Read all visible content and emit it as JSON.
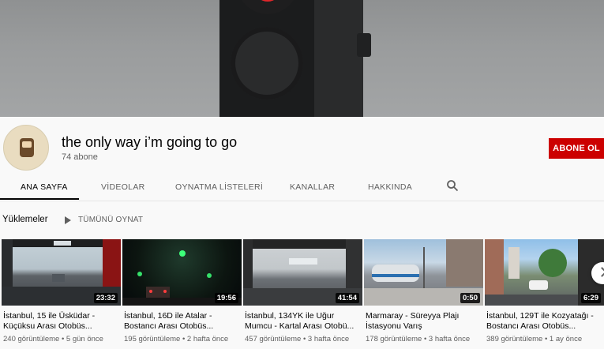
{
  "channel": {
    "title": "the only way i’m going to go",
    "subscribers": "74 abone",
    "subscribe_label": "ABONE OL"
  },
  "tabs": [
    {
      "label": "ANA SAYFA",
      "active": true
    },
    {
      "label": "VİDEOLAR",
      "active": false
    },
    {
      "label": "OYNATMA LİSTELERİ",
      "active": false
    },
    {
      "label": "KANALLAR",
      "active": false
    },
    {
      "label": "HAKKINDA",
      "active": false
    }
  ],
  "shelf": {
    "title": "Yüklemeler",
    "play_all_label": "TÜMÜNÜ OYNAT"
  },
  "videos": [
    {
      "title": "İstanbul, 15 ile Üsküdar - Küçüksu Arası Otobüs...",
      "duration": "23:32",
      "views": "240 görüntüleme",
      "age": "5 gün önce"
    },
    {
      "title": "İstanbul, 16D ile Atalar - Bostancı Arası Otobüs...",
      "duration": "19:56",
      "views": "195 görüntüleme",
      "age": "2 hafta önce"
    },
    {
      "title": "İstanbul, 134YK ile Uğur Mumcu - Kartal Arası Otobü...",
      "duration": "41:54",
      "views": "457 görüntüleme",
      "age": "3 hafta önce"
    },
    {
      "title": "Marmaray - Süreyya Plajı İstasyonu Varış",
      "duration": "0:50",
      "views": "178 görüntüleme",
      "age": "3 hafta önce"
    },
    {
      "title": "İstanbul, 129T ile Kozyatağı - Bostancı Arası Otobüs...",
      "duration": "6:29",
      "views": "389 görüntüleme",
      "age": "1 ay önce"
    }
  ],
  "meta_separator": " • ",
  "colors": {
    "subscribe_bg": "#cc0000",
    "text_primary": "#030303",
    "text_secondary": "#606060",
    "page_bg": "#f9f9f9"
  },
  "icons": [
    "search-icon",
    "play-all-icon",
    "scroll-next-icon"
  ]
}
